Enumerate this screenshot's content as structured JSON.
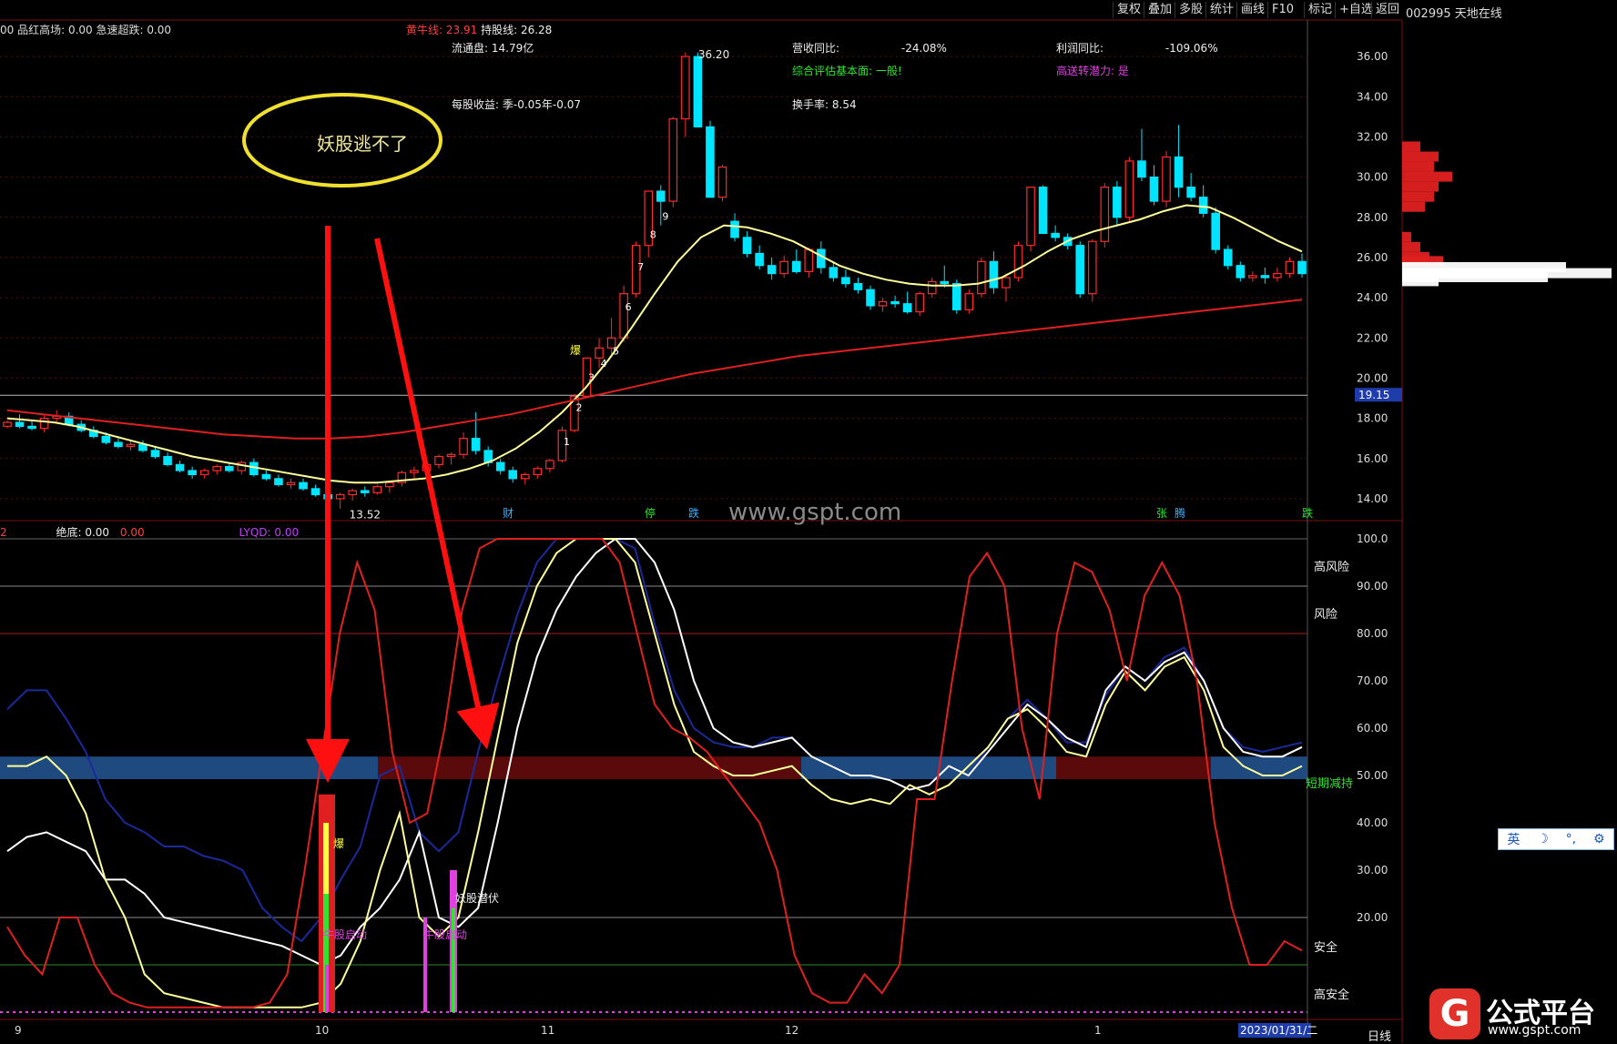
{
  "toolbar": {
    "buttons": [
      "复权",
      "叠加",
      "多股",
      "统计",
      "画线",
      "F10",
      "标记",
      "+自选",
      "返回"
    ],
    "stock_code": "002995",
    "stock_name": "天地在线"
  },
  "info_top": {
    "left_text": "00 品红高场: 0.00 急速超跌: 0.00",
    "yellow_cow_label": "黄牛线:",
    "yellow_cow_value": "23.91",
    "hold_label": "持股线:",
    "hold_value": "26.28",
    "float_label": "流通盘:",
    "float_value": "14.79亿",
    "eps_label": "每股收益:",
    "eps_value": "季-0.05年-0.07",
    "revenue_label": "营收同比:",
    "revenue_value": "-24.08%",
    "profit_label": "利润同比:",
    "profit_value": "-109.06%",
    "fundamental_label": "综合评估基本面:",
    "fundamental_value": "一般!",
    "bonus_label": "高送转潜力:",
    "bonus_value": "是",
    "turnover_label": "换手率:",
    "turnover_value": "8.54"
  },
  "annotation": {
    "ellipse_text": "妖股逃不了"
  },
  "watermark": "www.gspt.com",
  "price_axis": [
    "36.00",
    "34.00",
    "32.00",
    "30.00",
    "28.00",
    "26.00",
    "24.00",
    "22.00",
    "20.00",
    "18.00",
    "16.00",
    "14.00"
  ],
  "price_current": "19.15",
  "price_high_label": "36.20",
  "price_low_label": "13.52",
  "indicator_header": {
    "left": "2",
    "bottom_label": "绝底:",
    "bottom_value": "0.00",
    "bottom_value2": "0.00",
    "lyqd_label": "LYQD:",
    "lyqd_value": "0.00"
  },
  "indicator_axis": [
    "100.0",
    "90.00",
    "80.00",
    "70.00",
    "60.00",
    "50.00",
    "40.00",
    "30.00",
    "20.00"
  ],
  "zone_labels": {
    "high_risk": "高风险",
    "risk": "风险",
    "short_reduce": "短期减持",
    "safe": "安全",
    "high_safe": "高安全"
  },
  "signals": {
    "explode": "爆",
    "cow_start_1": "牛股启动",
    "cow_start_2": "牛股启动",
    "demon_lurk": "妖股潜伏",
    "price_explode": "爆"
  },
  "event_markers": [
    "财",
    "停",
    "跌",
    "张",
    "腾",
    "跌"
  ],
  "date_axis": [
    "9",
    "10",
    "11",
    "12",
    "1",
    "2023/01/31/二"
  ],
  "period_label": "日线",
  "ime_bar": [
    "英",
    "☽",
    "°,",
    "⚙"
  ],
  "logo": {
    "name": "公式平台",
    "url": "www.gspt.com"
  },
  "colors": {
    "up": "#ff2b2b",
    "down": "#00e5ff",
    "ma_short": "#ffff9a",
    "ma_long": "#e02020",
    "background": "#000000"
  },
  "chart_data": {
    "type": "candlestick",
    "candles": [
      [
        17.6,
        17.9,
        17.5,
        17.8
      ],
      [
        17.8,
        18.2,
        17.5,
        17.6
      ],
      [
        17.6,
        17.9,
        17.4,
        17.5
      ],
      [
        17.5,
        18.2,
        17.3,
        18.0
      ],
      [
        18.0,
        18.4,
        17.8,
        18.1
      ],
      [
        18.1,
        18.3,
        17.6,
        17.7
      ],
      [
        17.7,
        17.9,
        17.3,
        17.4
      ],
      [
        17.4,
        17.6,
        17.0,
        17.1
      ],
      [
        17.1,
        17.3,
        16.7,
        16.8
      ],
      [
        16.8,
        17.0,
        16.5,
        16.6
      ],
      [
        16.6,
        16.9,
        16.4,
        16.7
      ],
      [
        16.7,
        16.9,
        16.3,
        16.4
      ],
      [
        16.4,
        16.6,
        16.0,
        16.1
      ],
      [
        16.1,
        16.3,
        15.6,
        15.7
      ],
      [
        15.7,
        15.9,
        15.3,
        15.4
      ],
      [
        15.4,
        15.6,
        15.0,
        15.2
      ],
      [
        15.2,
        15.5,
        15.0,
        15.4
      ],
      [
        15.4,
        15.7,
        15.2,
        15.6
      ],
      [
        15.6,
        15.8,
        15.3,
        15.4
      ],
      [
        15.4,
        15.9,
        15.2,
        15.8
      ],
      [
        15.8,
        16.0,
        15.1,
        15.2
      ],
      [
        15.2,
        15.4,
        14.9,
        15.0
      ],
      [
        15.0,
        15.2,
        14.6,
        14.7
      ],
      [
        14.7,
        15.0,
        14.5,
        14.8
      ],
      [
        14.8,
        15.0,
        14.4,
        14.5
      ],
      [
        14.5,
        14.7,
        14.1,
        14.2
      ],
      [
        14.2,
        14.4,
        13.9,
        14.0
      ],
      [
        14.0,
        14.3,
        13.5,
        14.2
      ],
      [
        14.2,
        14.5,
        13.9,
        14.4
      ],
      [
        14.4,
        14.6,
        14.1,
        14.3
      ],
      [
        14.3,
        14.7,
        14.2,
        14.6
      ],
      [
        14.6,
        14.9,
        14.3,
        14.8
      ],
      [
        14.8,
        15.4,
        14.6,
        15.3
      ],
      [
        15.3,
        15.6,
        15.0,
        15.4
      ],
      [
        15.4,
        15.8,
        15.2,
        15.7
      ],
      [
        15.7,
        16.2,
        15.5,
        16.1
      ],
      [
        16.1,
        16.3,
        15.7,
        16.2
      ],
      [
        16.2,
        17.3,
        16.0,
        17.0
      ],
      [
        17.0,
        18.3,
        16.2,
        16.4
      ],
      [
        16.4,
        16.6,
        15.6,
        15.8
      ],
      [
        15.8,
        16.0,
        15.2,
        15.4
      ],
      [
        15.4,
        15.6,
        14.8,
        15.0
      ],
      [
        15.0,
        15.3,
        14.7,
        15.2
      ],
      [
        15.2,
        15.6,
        15.0,
        15.5
      ],
      [
        15.5,
        16.0,
        15.3,
        15.9
      ],
      [
        15.9,
        17.6,
        15.8,
        17.4
      ],
      [
        17.4,
        19.2,
        17.3,
        19.1
      ],
      [
        19.1,
        21.0,
        19.0,
        21.0
      ],
      [
        21.0,
        22.0,
        20.5,
        21.5
      ],
      [
        21.5,
        23.0,
        21.2,
        22.0
      ],
      [
        22.0,
        24.6,
        21.8,
        24.2
      ],
      [
        24.2,
        26.8,
        24.0,
        26.6
      ],
      [
        26.6,
        29.3,
        26.0,
        29.3
      ],
      [
        29.3,
        29.6,
        27.6,
        28.8
      ],
      [
        28.8,
        33.0,
        28.5,
        32.9
      ],
      [
        32.9,
        36.2,
        32.0,
        36.0
      ],
      [
        36.0,
        36.2,
        32.5,
        32.5
      ],
      [
        32.5,
        32.8,
        29.0,
        29.0
      ],
      [
        29.0,
        30.6,
        28.8,
        30.5
      ],
      [
        27.8,
        28.2,
        26.8,
        27.0
      ],
      [
        27.0,
        27.3,
        26.0,
        26.2
      ],
      [
        26.2,
        26.6,
        25.4,
        25.6
      ],
      [
        25.6,
        26.0,
        24.9,
        25.2
      ],
      [
        25.2,
        26.1,
        25.0,
        25.8
      ],
      [
        25.8,
        26.4,
        25.2,
        25.3
      ],
      [
        25.3,
        26.5,
        25.0,
        26.4
      ],
      [
        26.4,
        26.8,
        25.2,
        25.5
      ],
      [
        25.5,
        25.8,
        24.8,
        25.0
      ],
      [
        25.0,
        25.4,
        24.5,
        24.7
      ],
      [
        24.7,
        25.0,
        24.2,
        24.4
      ],
      [
        24.4,
        24.6,
        23.4,
        23.6
      ],
      [
        23.6,
        24.0,
        23.3,
        23.8
      ],
      [
        23.8,
        24.1,
        23.5,
        23.7
      ],
      [
        23.7,
        24.3,
        23.2,
        23.3
      ],
      [
        23.3,
        24.3,
        23.1,
        24.2
      ],
      [
        24.2,
        25.0,
        24.0,
        24.8
      ],
      [
        24.8,
        25.6,
        24.5,
        24.7
      ],
      [
        24.7,
        24.9,
        23.2,
        23.4
      ],
      [
        23.4,
        24.4,
        23.2,
        24.2
      ],
      [
        24.2,
        26.0,
        24.0,
        25.8
      ],
      [
        25.8,
        26.3,
        24.2,
        24.5
      ],
      [
        24.5,
        25.2,
        23.8,
        25.0
      ],
      [
        25.0,
        26.8,
        24.8,
        26.6
      ],
      [
        26.6,
        29.5,
        26.3,
        29.5
      ],
      [
        29.5,
        29.6,
        27.2,
        27.2
      ],
      [
        27.2,
        27.6,
        26.8,
        27.0
      ],
      [
        27.0,
        27.2,
        26.4,
        26.6
      ],
      [
        26.6,
        26.8,
        24.0,
        24.2
      ],
      [
        24.2,
        26.9,
        23.8,
        26.8
      ],
      [
        26.8,
        29.7,
        26.5,
        29.5
      ],
      [
        29.5,
        29.8,
        27.6,
        28.0
      ],
      [
        28.0,
        31.0,
        27.8,
        30.8
      ],
      [
        30.8,
        32.4,
        29.8,
        30.0
      ],
      [
        30.0,
        30.6,
        28.6,
        28.8
      ],
      [
        28.8,
        31.3,
        28.5,
        31.0
      ],
      [
        31.0,
        32.6,
        29.0,
        29.5
      ],
      [
        29.5,
        30.2,
        28.8,
        29.0
      ],
      [
        29.0,
        29.6,
        28.0,
        28.2
      ],
      [
        28.2,
        28.5,
        26.2,
        26.4
      ],
      [
        26.4,
        26.6,
        25.4,
        25.6
      ],
      [
        25.6,
        25.8,
        24.8,
        25.0
      ],
      [
        25.0,
        25.3,
        24.8,
        25.1
      ],
      [
        25.1,
        25.5,
        24.7,
        25.0
      ],
      [
        25.0,
        25.5,
        24.8,
        25.2
      ],
      [
        25.2,
        26.0,
        25.0,
        25.8
      ],
      [
        25.8,
        26.2,
        25.0,
        25.2
      ]
    ],
    "ma_short": [
      18.0,
      17.9,
      17.8,
      17.6,
      17.3,
      17.0,
      16.7,
      16.4,
      16.1,
      15.9,
      15.7,
      15.5,
      15.3,
      15.1,
      14.9,
      14.8,
      14.8,
      14.9,
      15.0,
      15.2,
      15.5,
      15.9,
      16.5,
      17.3,
      18.3,
      19.5,
      20.9,
      22.5,
      24.2,
      25.8,
      27.0,
      27.6,
      27.5,
      27.2,
      26.8,
      26.2,
      25.6,
      25.2,
      24.9,
      24.7,
      24.6,
      24.6,
      24.7,
      25.0,
      25.6,
      26.3,
      26.9,
      27.3,
      27.6,
      27.9,
      28.3,
      28.6,
      28.5,
      28.0,
      27.4,
      26.8,
      26.3
    ],
    "ma_long": [
      18.4,
      18.2,
      18.0,
      17.8,
      17.6,
      17.4,
      17.2,
      17.1,
      17.0,
      17.0,
      17.1,
      17.3,
      17.6,
      17.9,
      18.2,
      18.6,
      19.0,
      19.4,
      19.8,
      20.2,
      20.5,
      20.8,
      21.1,
      21.3,
      21.5,
      21.7,
      21.9,
      22.1,
      22.3,
      22.5,
      22.7,
      22.9,
      23.1,
      23.3,
      23.5,
      23.7,
      23.9
    ],
    "ylim": [
      13.0,
      37.0
    ],
    "indicator": {
      "ylim": [
        0,
        100
      ],
      "red_line": [
        18,
        12,
        8,
        20,
        20,
        10,
        4,
        2,
        1,
        1,
        1,
        1,
        1,
        1,
        1,
        2,
        8,
        30,
        55,
        80,
        95,
        85,
        55,
        40,
        42,
        60,
        85,
        98,
        100,
        100,
        100,
        100,
        100,
        100,
        100,
        95,
        80,
        65,
        60,
        58,
        55,
        50,
        45,
        40,
        30,
        12,
        4,
        2,
        2,
        8,
        4,
        10,
        45,
        45,
        70,
        92,
        97,
        90,
        60,
        45,
        80,
        95,
        93,
        85,
        70,
        88,
        95,
        88,
        70,
        40,
        22,
        10,
        10,
        15,
        13
      ],
      "white_line": [
        34,
        37,
        38,
        36,
        34,
        28,
        28,
        25,
        20,
        19,
        18,
        17,
        16,
        15,
        14,
        12,
        10,
        12,
        18,
        22,
        28,
        38,
        20,
        18,
        22,
        40,
        60,
        75,
        85,
        92,
        97,
        100,
        100,
        95,
        85,
        70,
        60,
        57,
        56,
        57,
        58,
        54,
        52,
        50,
        50,
        49,
        47,
        48,
        52,
        50,
        55,
        60,
        65,
        62,
        58,
        56,
        68,
        73,
        70,
        74,
        76,
        70,
        60,
        55,
        54,
        54,
        56
      ],
      "yellow_line": [
        52,
        52,
        54,
        50,
        42,
        28,
        20,
        8,
        4,
        3,
        2,
        1,
        1,
        1,
        1,
        1,
        2,
        6,
        15,
        30,
        42,
        20,
        16,
        20,
        38,
        58,
        78,
        90,
        97,
        100,
        100,
        100,
        95,
        80,
        65,
        55,
        52,
        50,
        50,
        51,
        52,
        48,
        45,
        44,
        45,
        44,
        48,
        46,
        48,
        52,
        56,
        62,
        64,
        60,
        55,
        54,
        65,
        72,
        68,
        73,
        75,
        68,
        56,
        52,
        50,
        50,
        52
      ],
      "blue_line": [
        64,
        68,
        68,
        62,
        55,
        45,
        40,
        38,
        35,
        35,
        33,
        32,
        30,
        22,
        18,
        15,
        20,
        28,
        35,
        50,
        52,
        38,
        34,
        38,
        55,
        70,
        84,
        95,
        100,
        100,
        100,
        100,
        98,
        82,
        68,
        60,
        57,
        56,
        56,
        58,
        58,
        54,
        52,
        50,
        50,
        49,
        47,
        48,
        52,
        50,
        56,
        62,
        66,
        62,
        57,
        57,
        67,
        73,
        70,
        75,
        77,
        70,
        60,
        56,
        55,
        56,
        57
      ],
      "band_zones": [
        "blue",
        "red",
        "blue",
        "red",
        "blue"
      ]
    }
  }
}
